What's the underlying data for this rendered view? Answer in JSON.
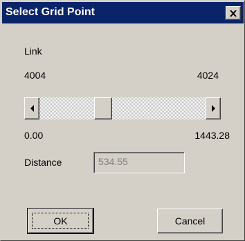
{
  "window": {
    "title": "Select Grid Point",
    "close_icon": "close-icon"
  },
  "link": {
    "label": "Link",
    "start_node": "4004",
    "end_node": "4024"
  },
  "slider": {
    "position_fraction": 0.37,
    "min_label": "0.00",
    "max_label": "1443.28"
  },
  "distance": {
    "label": "Distance",
    "value": "534.55"
  },
  "buttons": {
    "ok_label": "OK",
    "cancel_label": "Cancel"
  }
}
